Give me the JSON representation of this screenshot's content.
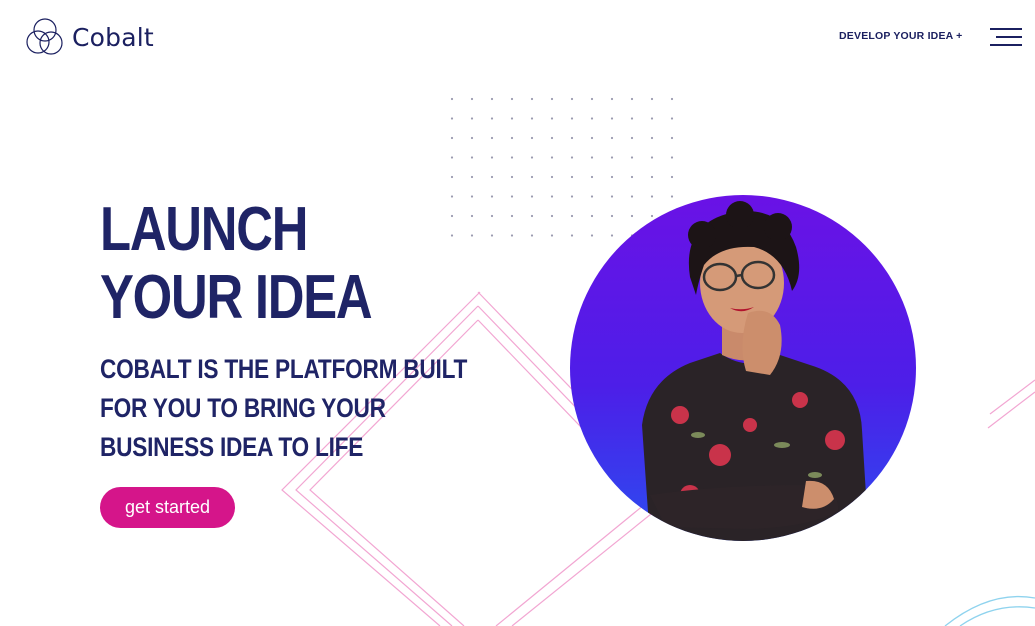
{
  "header": {
    "brand_name": "Cobalt",
    "nav_cta_label": "DEVELOP YOUR IDEA +",
    "menu_icon": "hamburger-menu-icon",
    "logo_icon": "interlocking-circles-logo-icon"
  },
  "hero": {
    "headline_line1": "LAUNCH",
    "headline_line2": "YOUR IDEA",
    "subhead_line1": "COBALT IS THE PLATFORM BUILT",
    "subhead_line2": "FOR YOU TO BRING YOUR",
    "subhead_line3": "BUSINESS IDEA TO LIFE",
    "cta_label": "get started"
  },
  "colors": {
    "brand_navy": "#1f2466",
    "accent_magenta": "#d5158a",
    "circle_violet": "#6a12e6",
    "circle_blue": "#2b4df0",
    "line_pink": "#f2a6d2",
    "line_cyan": "#8fd3ee"
  }
}
